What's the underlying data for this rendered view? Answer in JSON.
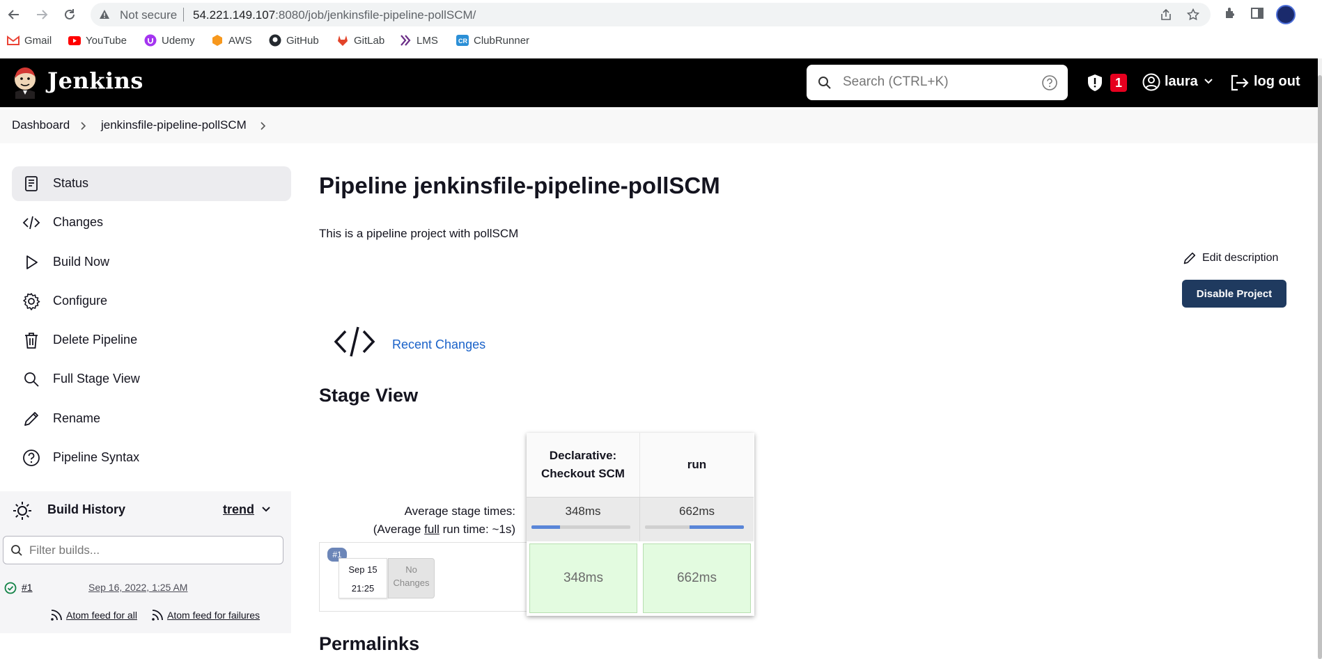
{
  "browser": {
    "security_label": "Not secure",
    "url_host": "54.221.149.107",
    "url_rest": ":8080/job/jenkinsfile-pipeline-pollSCM/",
    "bookmarks": [
      "Gmail",
      "YouTube",
      "Udemy",
      "AWS",
      "GitHub",
      "GitLab",
      "LMS",
      "ClubRunner"
    ]
  },
  "header": {
    "app_name": "Jenkins",
    "search_placeholder": "Search (CTRL+K)",
    "alert_count": "1",
    "username": "laura",
    "logout_label": "log out"
  },
  "breadcrumb": [
    "Dashboard",
    "jenkinsfile-pipeline-pollSCM"
  ],
  "sidebar": {
    "items": [
      {
        "label": "Status",
        "icon": "status-icon",
        "active": true
      },
      {
        "label": "Changes",
        "icon": "code-icon"
      },
      {
        "label": "Build Now",
        "icon": "play-icon"
      },
      {
        "label": "Configure",
        "icon": "gear-icon"
      },
      {
        "label": "Delete Pipeline",
        "icon": "trash-icon"
      },
      {
        "label": "Full Stage View",
        "icon": "search-icon"
      },
      {
        "label": "Rename",
        "icon": "pencil-icon"
      },
      {
        "label": "Pipeline Syntax",
        "icon": "help-icon"
      }
    ]
  },
  "build_history": {
    "title": "Build History",
    "trend_label": "trend",
    "filter_placeholder": "Filter builds...",
    "builds": [
      {
        "number": "#1",
        "date": "Sep 16, 2022, 1:25 AM",
        "status": "success"
      }
    ],
    "feed_all": "Atom feed for all",
    "feed_failures": "Atom feed for failures"
  },
  "main": {
    "title": "Pipeline jenkinsfile-pipeline-pollSCM",
    "description": "This is a pipeline project with pollSCM",
    "edit_description": "Edit description",
    "disable_button": "Disable Project",
    "recent_changes": "Recent Changes",
    "stage_view_title": "Stage View",
    "permalinks_title": "Permalinks"
  },
  "stage_view": {
    "avg_label": "Average stage times:",
    "avg_full_prefix": "(Average ",
    "avg_full_link": "full",
    "avg_full_suffix": " run time: ~1s)",
    "stages": [
      {
        "name_line1": "Declarative:",
        "name_line2": "Checkout SCM",
        "avg": "348ms",
        "avg_fraction": 0.29,
        "cell": "348ms"
      },
      {
        "name_line1": "run",
        "name_line2": "",
        "avg": "662ms",
        "avg_fraction": 0.55,
        "cell": "662ms"
      }
    ],
    "run": {
      "badge": "#1",
      "date": "Sep 15",
      "time": "21:25",
      "changes_line1": "No",
      "changes_line2": "Changes"
    }
  }
}
